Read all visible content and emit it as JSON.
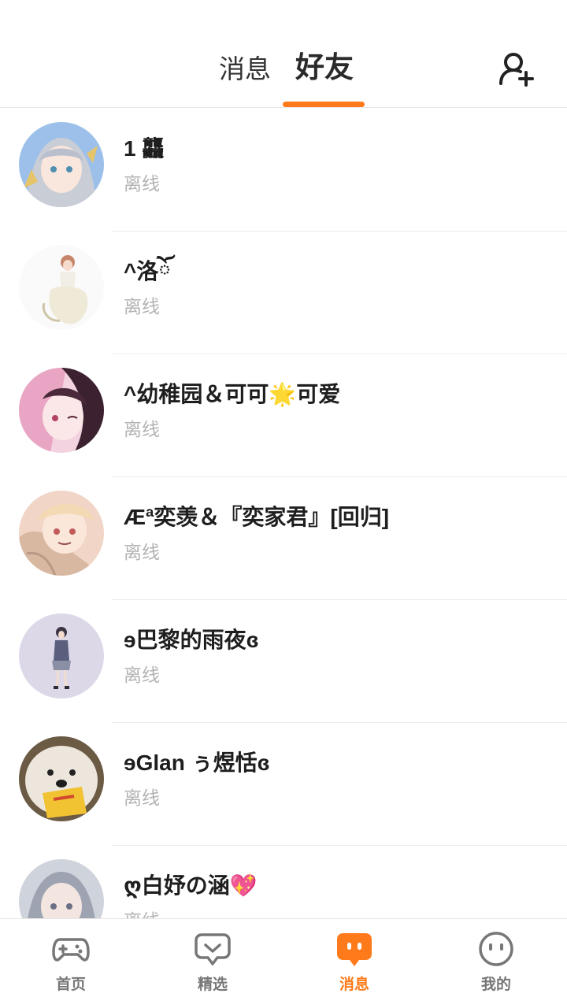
{
  "header": {
    "tabs": [
      {
        "label": "消息"
      },
      {
        "label": "好友"
      }
    ],
    "active_tab": "好友",
    "accent": "#ff7a1a",
    "add_icon": "add-friend-icon"
  },
  "friends": [
    {
      "name": "1 龘",
      "status": "离线"
    },
    {
      "name": "^洛ོ",
      "status": "离线"
    },
    {
      "name": "^幼稚园＆可可🌟可爱",
      "status": "离线"
    },
    {
      "name": "Æª奕羡＆『奕家君』[回归]",
      "status": "离线"
    },
    {
      "name": "ɘ巴黎的雨夜ɞ",
      "status": "离线"
    },
    {
      "name": "ɘGlan ぅ煜恬ɞ",
      "status": "离线"
    },
    {
      "name": "ღ白妤の涵💖",
      "status": "离线"
    }
  ],
  "bottom_nav": [
    {
      "label": "首页",
      "icon": "gamepad-icon"
    },
    {
      "label": "精选",
      "icon": "heart-chat-icon"
    },
    {
      "label": "消息",
      "icon": "message-icon"
    },
    {
      "label": "我的",
      "icon": "face-icon"
    }
  ],
  "active_nav": "消息"
}
